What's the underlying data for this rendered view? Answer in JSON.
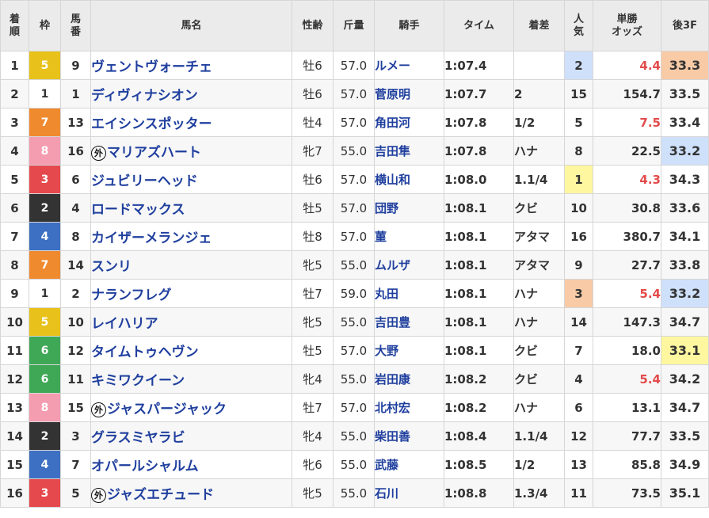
{
  "headers": {
    "rank": [
      "着",
      "順"
    ],
    "gate": "枠",
    "num": [
      "馬",
      "番"
    ],
    "horse": "馬名",
    "sexage": "性齢",
    "weight": "斤量",
    "jockey": "騎手",
    "time": "タイム",
    "margin": "着差",
    "pop": [
      "人",
      "気"
    ],
    "odds": [
      "単勝",
      "オッズ"
    ],
    "last3f": "後3F"
  },
  "gai_mark": "外",
  "rows": [
    {
      "rank": "1",
      "gate": "5",
      "num": "9",
      "horse": "ヴェントヴォーチェ",
      "gai": false,
      "sexage": "牡6",
      "weight": "57.0",
      "jockey": "ルメー",
      "time": "1:07.4",
      "margin": "",
      "pop": "2",
      "odds": "4.4",
      "odds_fav": true,
      "last3f": "33.3",
      "pop_hl": "blue",
      "l3_hl": "orange"
    },
    {
      "rank": "2",
      "gate": "1",
      "num": "1",
      "horse": "ディヴィナシオン",
      "gai": false,
      "sexage": "牡6",
      "weight": "57.0",
      "jockey": "菅原明",
      "time": "1:07.7",
      "margin": "2",
      "pop": "15",
      "odds": "154.7",
      "odds_fav": false,
      "last3f": "33.5",
      "pop_hl": "",
      "l3_hl": ""
    },
    {
      "rank": "3",
      "gate": "7",
      "num": "13",
      "horse": "エイシンスポッター",
      "gai": false,
      "sexage": "牡4",
      "weight": "57.0",
      "jockey": "角田河",
      "time": "1:07.8",
      "margin": "1/2",
      "pop": "5",
      "odds": "7.5",
      "odds_fav": true,
      "last3f": "33.4",
      "pop_hl": "",
      "l3_hl": ""
    },
    {
      "rank": "4",
      "gate": "8",
      "num": "16",
      "horse": "マリアズハート",
      "gai": true,
      "sexage": "牝7",
      "weight": "55.0",
      "jockey": "吉田隼",
      "time": "1:07.8",
      "margin": "ハナ",
      "pop": "8",
      "odds": "22.5",
      "odds_fav": false,
      "last3f": "33.2",
      "pop_hl": "",
      "l3_hl": "blue"
    },
    {
      "rank": "5",
      "gate": "3",
      "num": "6",
      "horse": "ジュビリーヘッド",
      "gai": false,
      "sexage": "牡6",
      "weight": "57.0",
      "jockey": "横山和",
      "time": "1:08.0",
      "margin": "1.1/4",
      "pop": "1",
      "odds": "4.3",
      "odds_fav": true,
      "last3f": "34.3",
      "pop_hl": "yellow",
      "l3_hl": ""
    },
    {
      "rank": "6",
      "gate": "2",
      "num": "4",
      "horse": "ロードマックス",
      "gai": false,
      "sexage": "牡5",
      "weight": "57.0",
      "jockey": "団野",
      "time": "1:08.1",
      "margin": "クビ",
      "pop": "10",
      "odds": "30.8",
      "odds_fav": false,
      "last3f": "33.6",
      "pop_hl": "",
      "l3_hl": ""
    },
    {
      "rank": "7",
      "gate": "4",
      "num": "8",
      "horse": "カイザーメランジェ",
      "gai": false,
      "sexage": "牡8",
      "weight": "57.0",
      "jockey": "菫",
      "time": "1:08.1",
      "margin": "アタマ",
      "pop": "16",
      "odds": "380.7",
      "odds_fav": false,
      "last3f": "34.1",
      "pop_hl": "",
      "l3_hl": ""
    },
    {
      "rank": "8",
      "gate": "7",
      "num": "14",
      "horse": "スンリ",
      "gai": false,
      "sexage": "牝5",
      "weight": "55.0",
      "jockey": "ムルザ",
      "time": "1:08.1",
      "margin": "アタマ",
      "pop": "9",
      "odds": "27.7",
      "odds_fav": false,
      "last3f": "33.8",
      "pop_hl": "",
      "l3_hl": ""
    },
    {
      "rank": "9",
      "gate": "1",
      "num": "2",
      "horse": "ナランフレグ",
      "gai": false,
      "sexage": "牡7",
      "weight": "59.0",
      "jockey": "丸田",
      "time": "1:08.1",
      "margin": "ハナ",
      "pop": "3",
      "odds": "5.4",
      "odds_fav": true,
      "last3f": "33.2",
      "pop_hl": "orange",
      "l3_hl": "blue"
    },
    {
      "rank": "10",
      "gate": "5",
      "num": "10",
      "horse": "レイハリア",
      "gai": false,
      "sexage": "牝5",
      "weight": "55.0",
      "jockey": "吉田豊",
      "time": "1:08.1",
      "margin": "ハナ",
      "pop": "14",
      "odds": "147.3",
      "odds_fav": false,
      "last3f": "34.7",
      "pop_hl": "",
      "l3_hl": ""
    },
    {
      "rank": "11",
      "gate": "6",
      "num": "12",
      "horse": "タイムトゥヘヴン",
      "gai": false,
      "sexage": "牡5",
      "weight": "57.0",
      "jockey": "大野",
      "time": "1:08.1",
      "margin": "クビ",
      "pop": "7",
      "odds": "18.0",
      "odds_fav": false,
      "last3f": "33.1",
      "pop_hl": "",
      "l3_hl": "yellow"
    },
    {
      "rank": "12",
      "gate": "6",
      "num": "11",
      "horse": "キミワクイーン",
      "gai": false,
      "sexage": "牝4",
      "weight": "55.0",
      "jockey": "岩田康",
      "time": "1:08.2",
      "margin": "クビ",
      "pop": "4",
      "odds": "5.4",
      "odds_fav": true,
      "last3f": "34.2",
      "pop_hl": "",
      "l3_hl": ""
    },
    {
      "rank": "13",
      "gate": "8",
      "num": "15",
      "horse": "ジャスパージャック",
      "gai": true,
      "sexage": "牡7",
      "weight": "57.0",
      "jockey": "北村宏",
      "time": "1:08.2",
      "margin": "ハナ",
      "pop": "6",
      "odds": "13.1",
      "odds_fav": false,
      "last3f": "34.7",
      "pop_hl": "",
      "l3_hl": ""
    },
    {
      "rank": "14",
      "gate": "2",
      "num": "3",
      "horse": "グラスミヤラビ",
      "gai": false,
      "sexage": "牝4",
      "weight": "55.0",
      "jockey": "柴田善",
      "time": "1:08.4",
      "margin": "1.1/4",
      "pop": "12",
      "odds": "77.7",
      "odds_fav": false,
      "last3f": "33.5",
      "pop_hl": "",
      "l3_hl": ""
    },
    {
      "rank": "15",
      "gate": "4",
      "num": "7",
      "horse": "オパールシャルム",
      "gai": false,
      "sexage": "牝6",
      "weight": "55.0",
      "jockey": "武藤",
      "time": "1:08.5",
      "margin": "1/2",
      "pop": "13",
      "odds": "85.8",
      "odds_fav": false,
      "last3f": "34.9",
      "pop_hl": "",
      "l3_hl": ""
    },
    {
      "rank": "16",
      "gate": "3",
      "num": "5",
      "horse": "ジャズエチュード",
      "gai": true,
      "sexage": "牝5",
      "weight": "55.0",
      "jockey": "石川",
      "time": "1:08.8",
      "margin": "1.3/4",
      "pop": "11",
      "odds": "73.5",
      "odds_fav": false,
      "last3f": "35.1",
      "pop_hl": "",
      "l3_hl": ""
    }
  ]
}
